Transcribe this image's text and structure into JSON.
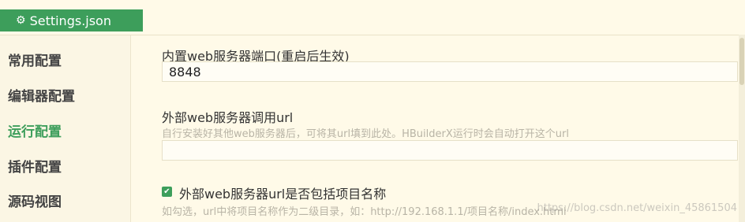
{
  "tab": {
    "label": "Settings.json",
    "icon": "gear-icon"
  },
  "sidebar": {
    "items": [
      {
        "label": "常用配置"
      },
      {
        "label": "编辑器配置"
      },
      {
        "label": "运行配置",
        "active": true
      },
      {
        "label": "插件配置"
      },
      {
        "label": "源码视图"
      }
    ]
  },
  "settings": {
    "port": {
      "label": "内置web服务器端口(重启后生效)",
      "value": "8848"
    },
    "external_url": {
      "label": "外部web服务器调用url",
      "description": "自行安装好其他web服务器后，可将其url填到此处。HBuilderX运行时会自动打开这个url",
      "value": ""
    },
    "include_project": {
      "label": "外部web服务器url是否包括项目名称",
      "checked": true,
      "description": "如勾选，url中将项目名称作为二级目录，如：http://192.168.1.1/项目名称/index.html"
    }
  },
  "watermark": "https://blog.csdn.net/weixin_45861504",
  "colors": {
    "accent": "#3d9e5b",
    "background": "#fffae8"
  }
}
